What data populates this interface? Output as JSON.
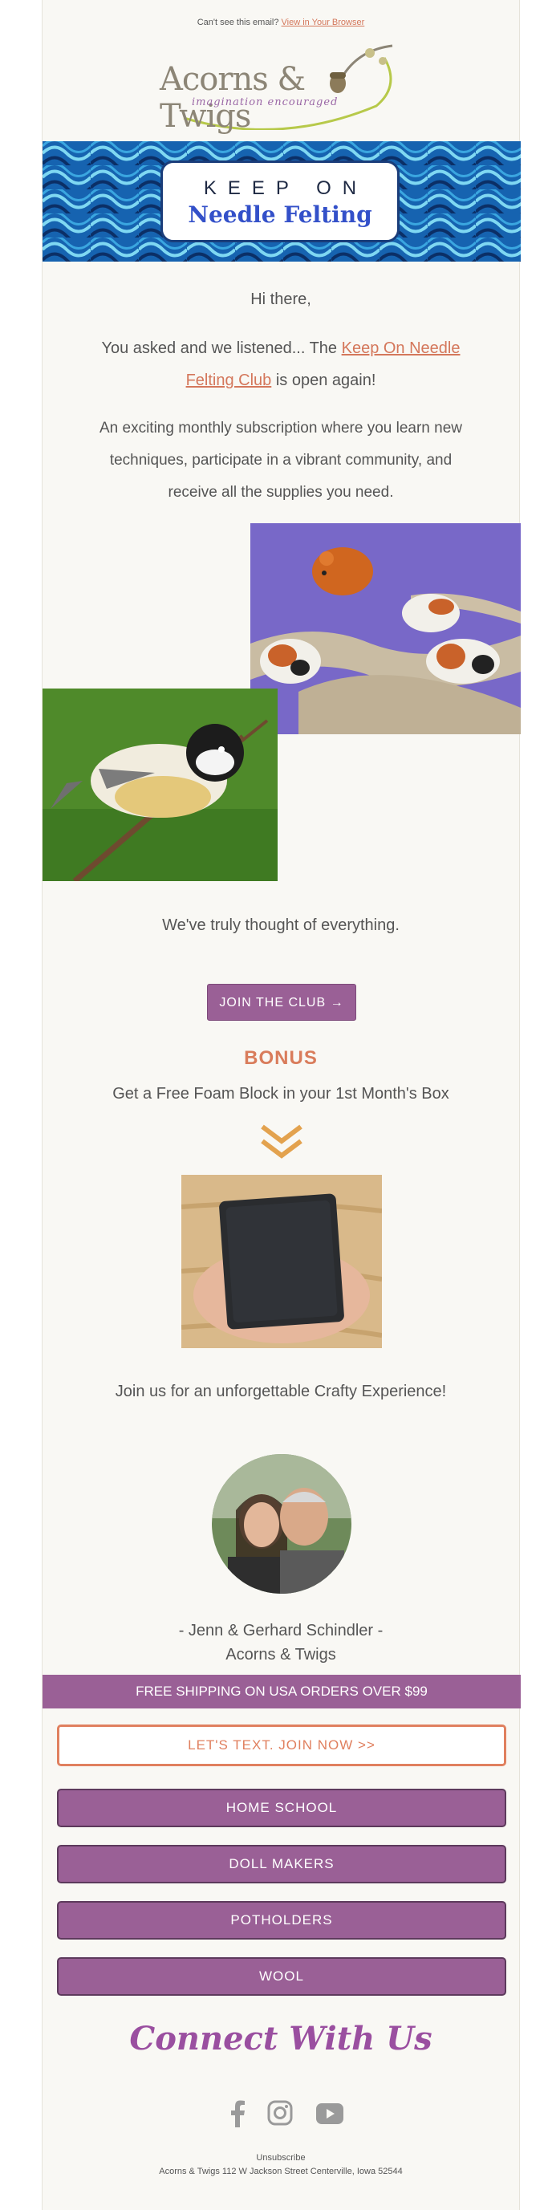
{
  "preheader": {
    "question": "Can't see this email?",
    "link": "View in Your Browser"
  },
  "logo": {
    "brand": "Acorns & Twigs",
    "tagline": "imagination encouraged"
  },
  "hero": {
    "line1": "KEEP ON",
    "line2": "Needle Felting"
  },
  "body": {
    "greeting": "Hi there,",
    "intro_prefix": "You asked and we listened... The ",
    "intro_link": "Keep On Needle Felting Club",
    "intro_suffix": " is open again!",
    "description": "An exciting monthly subscription where you learn new techniques, participate in a vibrant community, and receive all the supplies you need.",
    "thought": "We've truly thought of everything.",
    "join_button": "JOIN THE CLUB →",
    "bonus_title": "BONUS",
    "bonus_text": "Get a Free Foam Block in your 1st Month's Box",
    "join_us": "Join us for an unforgettable Crafty Experience!",
    "signature_names": "- Jenn & Gerhard Schindler -",
    "signature_company": "Acorns & Twigs"
  },
  "shipping_bar": "FREE SHIPPING ON USA ORDERS OVER $99",
  "text_button": "LET'S TEXT. JOIN NOW >>",
  "category_buttons": [
    "HOME SCHOOL",
    "DOLL MAKERS",
    "POTHOLDERS",
    "WOOL"
  ],
  "connect_heading": "Connect With Us",
  "social": [
    {
      "icon": "facebook-icon"
    },
    {
      "icon": "instagram-icon"
    },
    {
      "icon": "youtube-icon"
    }
  ],
  "footer": {
    "unsubscribe": "Unsubscribe",
    "address": "Acorns & Twigs 112 W Jackson Street Centerville, Iowa 52544"
  },
  "colors": {
    "accent_purple": "#9a6096",
    "accent_orange": "#d97c5b",
    "background": "#f9f8f4"
  }
}
